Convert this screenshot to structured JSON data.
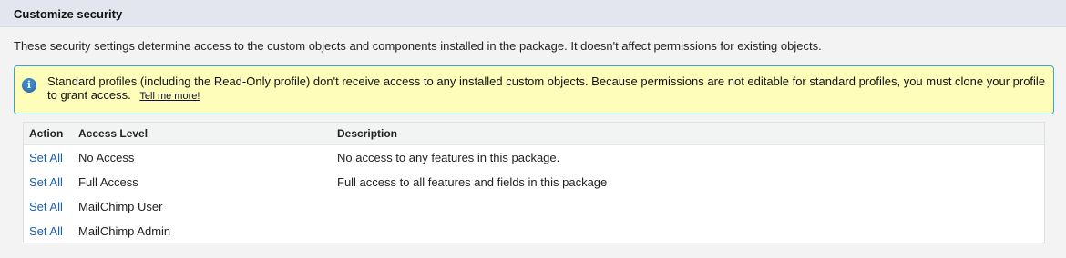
{
  "header": {
    "title": "Customize security"
  },
  "intro_text": "These security settings determine access to the custom objects and components installed in the package. It doesn't affect permissions for existing objects.",
  "info": {
    "icon": "info-icon",
    "text": "Standard profiles (including the Read-Only profile) don't receive access to any installed custom objects. Because permissions are not editable for standard profiles, you must clone your profile to grant access.",
    "link": "Tell me more!"
  },
  "table": {
    "headers": {
      "action": "Action",
      "access_level": "Access Level",
      "description": "Description"
    },
    "rows": [
      {
        "action": "Set All",
        "access_level": "No Access",
        "description": "No access to any features in this package."
      },
      {
        "action": "Set All",
        "access_level": "Full Access",
        "description": "Full access to all features and fields in this package"
      },
      {
        "action": "Set All",
        "access_level": "MailChimp User",
        "description": ""
      },
      {
        "action": "Set All",
        "access_level": "MailChimp Admin",
        "description": ""
      }
    ]
  },
  "colors": {
    "info_bg": "#fefdb9",
    "info_border": "#39a3dc",
    "link": "#1b5fb0",
    "header_bg": "#e3e6ee"
  }
}
